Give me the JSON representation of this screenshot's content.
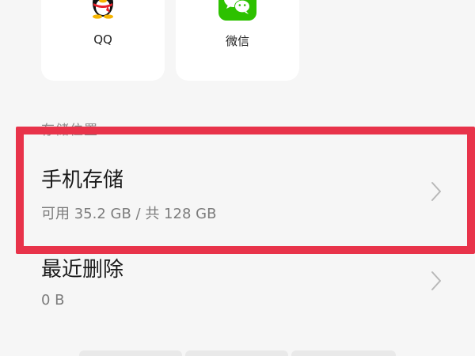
{
  "apps": [
    {
      "label": "QQ",
      "icon": "qq-penguin-icon"
    },
    {
      "label": "微信",
      "icon": "wechat-bubbles-icon"
    }
  ],
  "section_header": "存储位置",
  "storage": {
    "phone": {
      "title": "手机存储",
      "subtitle": "可用 35.2 GB / 共 128 GB"
    },
    "recent": {
      "title": "最近删除",
      "subtitle": "0 B"
    }
  },
  "colors": {
    "highlight": "#e8334a",
    "wechat_green": "#2dc100",
    "background": "#f6f6f6"
  }
}
